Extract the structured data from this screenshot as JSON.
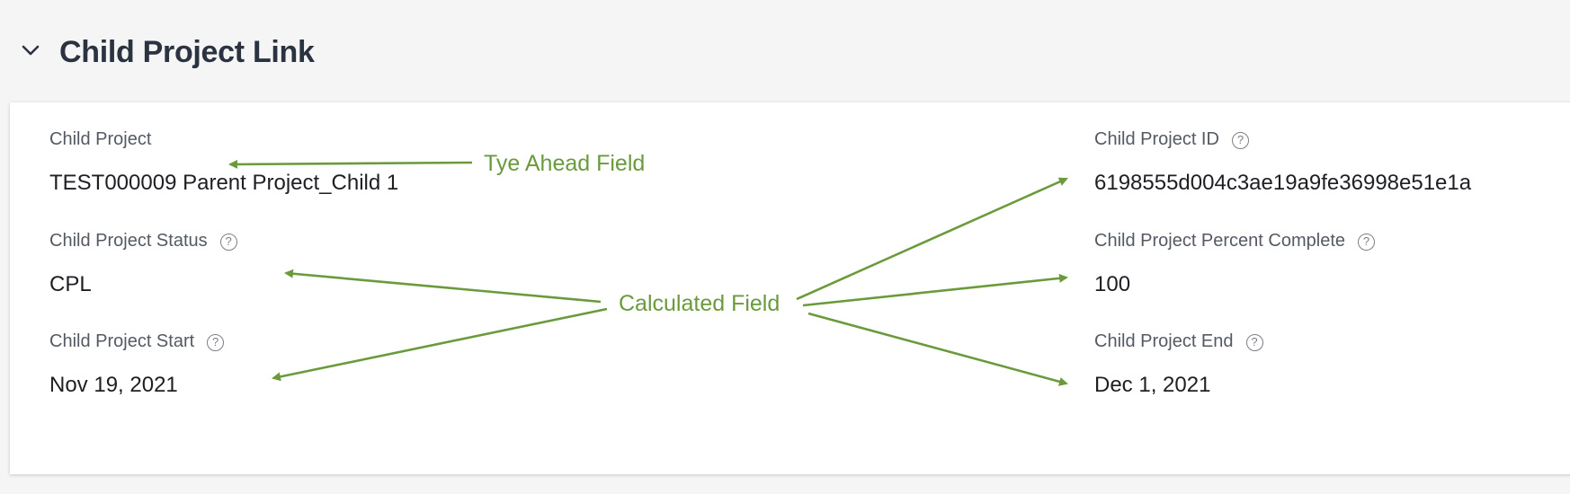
{
  "section": {
    "title": "Child Project Link",
    "chevron_icon": "chevron-down-icon"
  },
  "fields": {
    "child_project": {
      "label": "Child Project",
      "value": "TEST000009 Parent Project_Child 1"
    },
    "child_project_status": {
      "label": "Child Project Status",
      "value": "CPL"
    },
    "child_project_start": {
      "label": "Child Project Start",
      "value": "Nov 19, 2021"
    },
    "child_project_id": {
      "label": "Child Project ID",
      "value": "6198555d004c3ae19a9fe36998e51e1a"
    },
    "child_project_percent_complete": {
      "label": "Child Project Percent Complete",
      "value": "100"
    },
    "child_project_end": {
      "label": "Child Project End",
      "value": "Dec 1, 2021"
    }
  },
  "help_icon": {
    "glyph": "?",
    "icon": "help-circle-icon"
  },
  "annotations": {
    "type_ahead": "Tye Ahead Field",
    "calculated": "Calculated Field",
    "color": "#6a9a3c"
  },
  "colors": {
    "title": "#2b3240",
    "label": "#545a63",
    "value": "#1d1f23",
    "page_background": "#f5f5f5",
    "card_background": "#ffffff"
  }
}
